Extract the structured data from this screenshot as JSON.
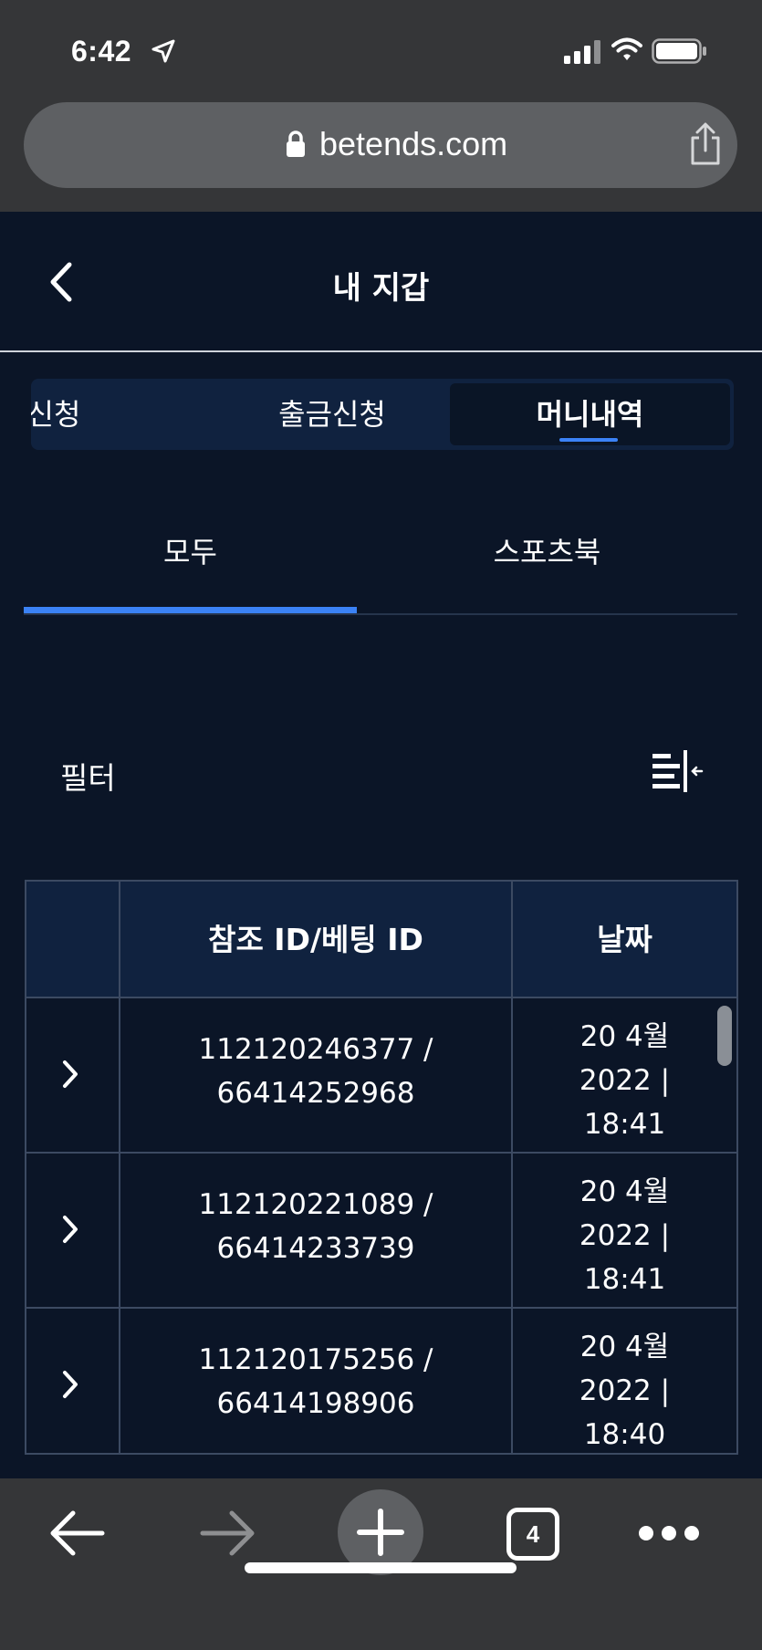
{
  "status_bar": {
    "time": "6:42",
    "icons": [
      "location-arrow-icon",
      "cellular-signal-icon",
      "wifi-icon",
      "battery-icon"
    ]
  },
  "browser": {
    "url": "betends.com",
    "tab_count": "4"
  },
  "header": {
    "title": "내 지갑"
  },
  "segment_tabs": [
    {
      "label": "신청"
    },
    {
      "label": "출금신청"
    },
    {
      "label": "머니내역",
      "active": true
    }
  ],
  "sub_tabs": [
    {
      "label": "모두",
      "active": true
    },
    {
      "label": "스포츠북"
    }
  ],
  "filter": {
    "label": "필터"
  },
  "table": {
    "columns": [
      "",
      "참조 ID/베팅 ID",
      "날짜"
    ],
    "rows": [
      {
        "ref": "112120246377 /",
        "bet": "66414252968",
        "date_l1": "20 4월",
        "date_l2": "2022 |",
        "date_l3": "18:41"
      },
      {
        "ref": "112120221089 /",
        "bet": "66414233739",
        "date_l1": "20 4월",
        "date_l2": "2022 |",
        "date_l3": "18:41"
      },
      {
        "ref": "112120175256 /",
        "bet": "66414198906",
        "date_l1": "20 4월",
        "date_l2": "2022 |",
        "date_l3": "18:40"
      }
    ]
  },
  "colors": {
    "background": "#0b1527",
    "panel": "#10223f",
    "accent": "#3b82f6",
    "browser_chrome": "#353638"
  }
}
